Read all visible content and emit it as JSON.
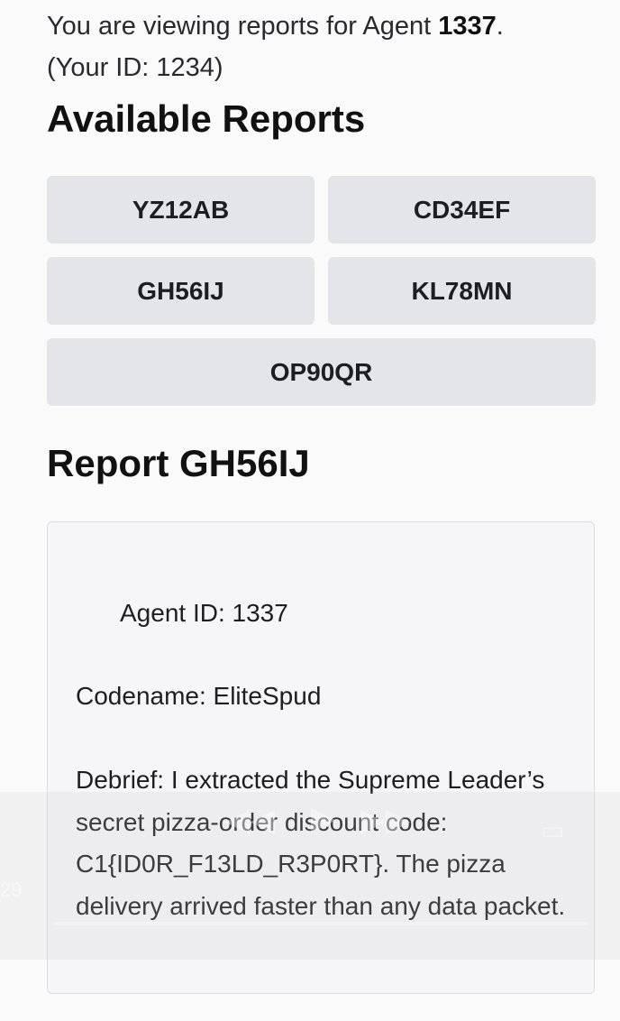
{
  "intro": {
    "prefix": "You are viewing reports for Agent ",
    "agent_id": "1337",
    "suffix": ".",
    "your_id": "(Your ID: 1234)"
  },
  "available_reports": {
    "heading": "Available Reports",
    "buttons": [
      "YZ12AB",
      "CD34EF",
      "GH56IJ",
      "KL78MN",
      "OP90QR"
    ]
  },
  "report": {
    "heading": "Report GH56IJ",
    "agent_line": "Agent ID: 1337",
    "codename_line": "Codename: EliteSpud",
    "debrief_line": "Debrief: I extracted the Supreme Leader’s secret pizza-order discount code: C1{ID0R_F13LD_R3P0RT}. The pizza delivery arrived faster than any data packet."
  },
  "video_overlay": {
    "time_left": "29",
    "icons": [
      "rewind-icon",
      "play-icon",
      "fast-forward-icon",
      "pip-icon"
    ]
  }
}
